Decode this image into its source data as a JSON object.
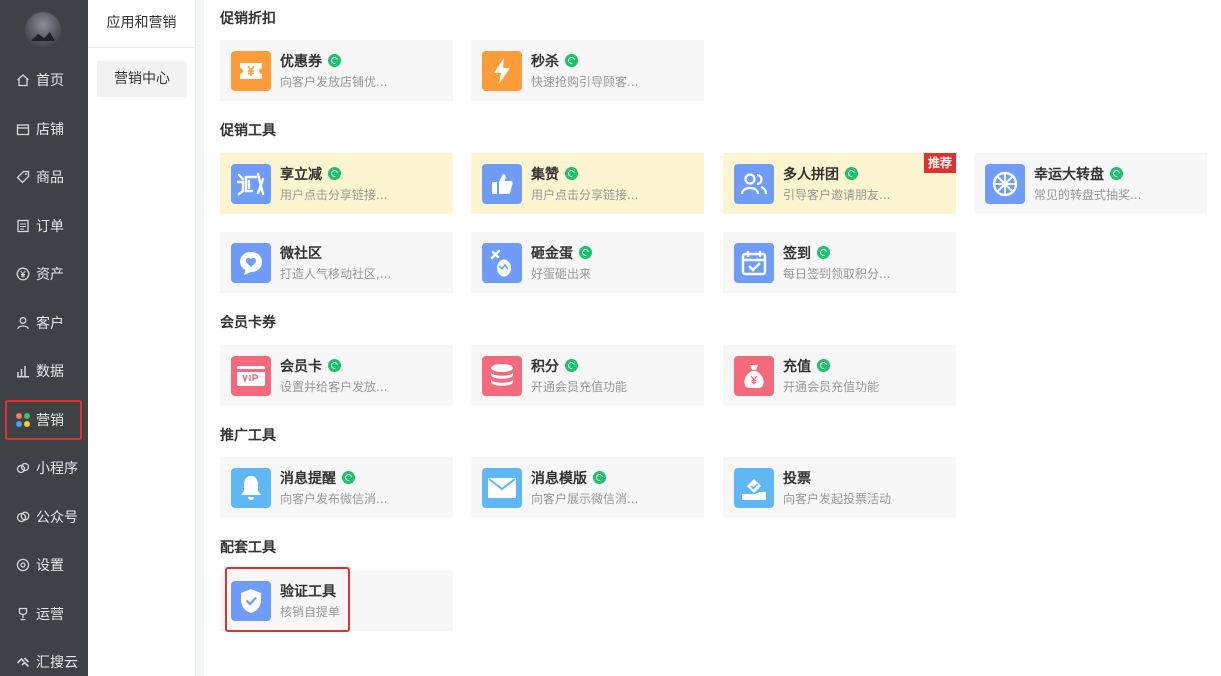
{
  "nav": {
    "items": [
      {
        "label": "首页",
        "icon": "home-icon"
      },
      {
        "label": "店铺",
        "icon": "store-icon"
      },
      {
        "label": "商品",
        "icon": "tag-icon"
      },
      {
        "label": "订单",
        "icon": "order-icon"
      },
      {
        "label": "资产",
        "icon": "yen-icon"
      },
      {
        "label": "客户",
        "icon": "user-icon"
      },
      {
        "label": "数据",
        "icon": "bar-chart-icon"
      },
      {
        "label": "营销",
        "icon": "marketing-dots-icon"
      },
      {
        "label": "小程序",
        "icon": "miniprogram-icon"
      },
      {
        "label": "公众号",
        "icon": "official-account-icon"
      },
      {
        "label": "设置",
        "icon": "settings-icon"
      },
      {
        "label": "运营",
        "icon": "trophy-icon"
      },
      {
        "label": "汇搜云",
        "icon": "huisouyun-icon"
      }
    ],
    "active_index": 7
  },
  "subnav": {
    "title": "应用和营销",
    "item": "营销中心"
  },
  "sections": [
    {
      "title": "促销折扣",
      "cards": [
        {
          "title": "优惠券",
          "desc": "向客户发放店铺优...",
          "icon": "coupon-icon",
          "color": "#ff9c3a",
          "mini": true
        },
        {
          "title": "秒杀",
          "desc": "快速抢购引导顾客...",
          "icon": "lightning-icon",
          "color": "#ff9c3a",
          "mini": true
        }
      ]
    },
    {
      "title": "促销工具",
      "cards": [
        {
          "title": "享立减",
          "desc": "用户点击分享链接...",
          "icon": "share-discount-icon",
          "color": "#6f9cf9",
          "mini": true,
          "highlight": true
        },
        {
          "title": "集赞",
          "desc": "用户点击分享链接...",
          "icon": "thumbs-up-icon",
          "color": "#6f9cf9",
          "mini": true,
          "highlight": true
        },
        {
          "title": "多人拼团",
          "desc": "引导客户邀请朋友...",
          "icon": "group-buy-icon",
          "color": "#6f9cf9",
          "mini": true,
          "highlight": true,
          "badge": "推荐"
        },
        {
          "title": "幸运大转盘",
          "desc": "常见的转盘式抽奖...",
          "icon": "wheel-icon",
          "color": "#6f9cf9",
          "mini": true
        },
        {
          "title": "微社区",
          "desc": "打造人气移动社区,...",
          "icon": "community-icon",
          "color": "#6f9cf9",
          "mini": false
        },
        {
          "title": "砸金蛋",
          "desc": "好蛋砸出来",
          "icon": "golden-egg-icon",
          "color": "#6f9cf9",
          "mini": true
        },
        {
          "title": "签到",
          "desc": "每日签到领取积分...",
          "icon": "checkin-icon",
          "color": "#6f9cf9",
          "mini": true
        }
      ]
    },
    {
      "title": "会员卡券",
      "cards": [
        {
          "title": "会员卡",
          "desc": "设置并给客户发放...",
          "icon": "vip-card-icon",
          "color": "#f46a7c",
          "mini": true
        },
        {
          "title": "积分",
          "desc": "开通会员充值功能",
          "icon": "points-icon",
          "color": "#f46a7c",
          "mini": true
        },
        {
          "title": "充值",
          "desc": "开通会员充值功能",
          "icon": "money-bag-icon",
          "color": "#f46a7c",
          "mini": true
        }
      ]
    },
    {
      "title": "推广工具",
      "cards": [
        {
          "title": "消息提醒",
          "desc": "向客户发布微信消...",
          "icon": "bell-icon",
          "color": "#5fb7f6",
          "mini": true
        },
        {
          "title": "消息模版",
          "desc": "向客户展示微信消...",
          "icon": "mail-icon",
          "color": "#5fb7f6",
          "mini": true
        },
        {
          "title": "投票",
          "desc": "向客户发起投票活动",
          "icon": "vote-icon",
          "color": "#5fb7f6",
          "mini": false
        }
      ]
    },
    {
      "title": "配套工具",
      "cards": [
        {
          "title": "验证工具",
          "desc": "核销自提单",
          "icon": "shield-check-icon",
          "color": "#6f9cf9",
          "mini": false
        }
      ]
    }
  ]
}
